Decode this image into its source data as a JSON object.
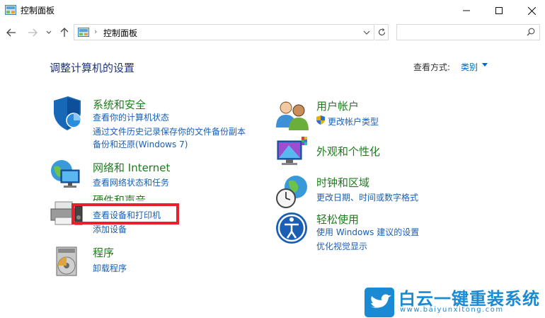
{
  "window": {
    "title": "控制面板",
    "minimize_icon": "minimize-icon",
    "maximize_icon": "maximize-icon",
    "close_icon": "close-icon"
  },
  "address": {
    "breadcrumb": "控制面板",
    "separator": "›",
    "search_placeholder": ""
  },
  "header": {
    "title": "调整计算机的设置",
    "view_by_label": "查看方式:",
    "view_by_value": "类别"
  },
  "categories": [
    {
      "icon": "security-shield-icon",
      "title": "系统和安全",
      "links": [
        "查看你的计算机状态",
        "通过文件历史记录保存你的文件备份副本",
        "备份和还原(Windows 7)"
      ]
    },
    {
      "icon": "network-globe-icon",
      "title": "网络和 Internet",
      "links": [
        "查看网络状态和任务"
      ]
    },
    {
      "icon": "printer-speaker-icon",
      "title": "硬件和声音",
      "links": [
        "查看设备和打印机",
        "添加设备"
      ]
    },
    {
      "icon": "programs-disc-icon",
      "title": "程序",
      "links": [
        "卸载程序"
      ]
    },
    {
      "icon": "user-accounts-icon",
      "title": "用户帐户",
      "links": [
        "更改帐户类型"
      ]
    },
    {
      "icon": "appearance-monitor-icon",
      "title": "外观和个性化",
      "links": []
    },
    {
      "icon": "clock-globe-icon",
      "title": "时钟和区域",
      "links": [
        "更改日期、时间或数字格式"
      ]
    },
    {
      "icon": "ease-of-access-icon",
      "title": "轻松使用",
      "links": [
        "使用 Windows 建议的设置",
        "优化视觉显示"
      ]
    }
  ],
  "watermark": {
    "brand": "白云一键重装系统",
    "url": "www.baiyunxitong.com"
  }
}
